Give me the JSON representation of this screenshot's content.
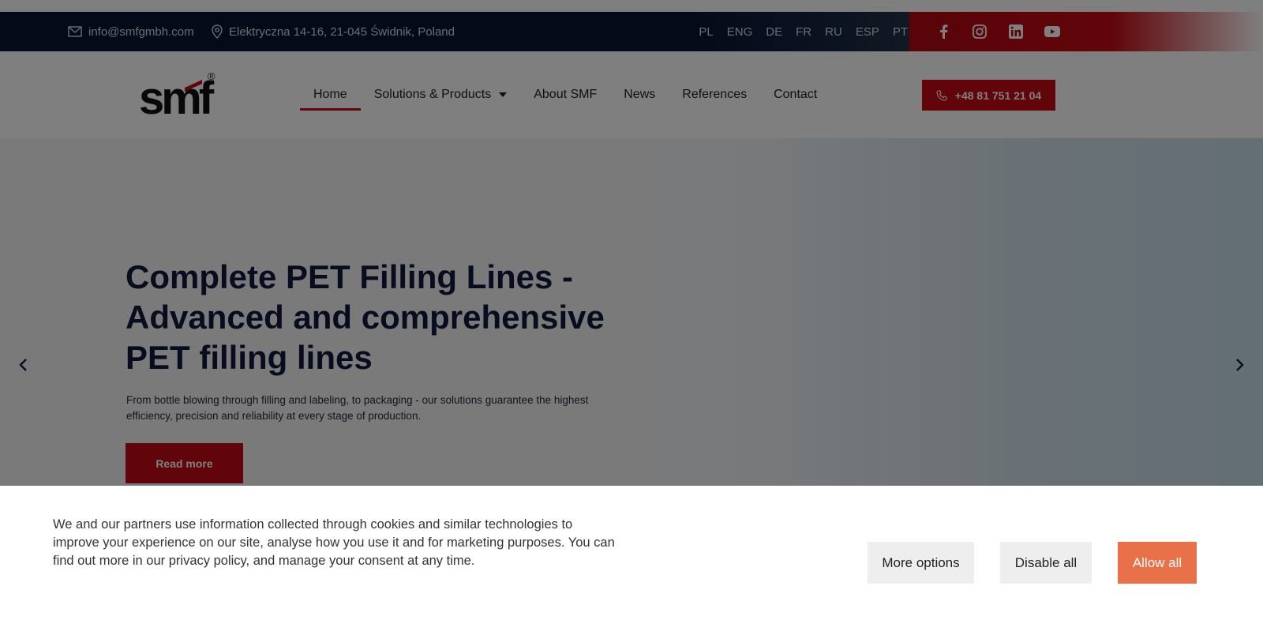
{
  "topbar": {
    "email": "info@smfgmbh.com",
    "address": "Elektryczna 14-16, 21-045 Świdnik, Poland",
    "languages": [
      "PL",
      "ENG",
      "DE",
      "FR",
      "RU",
      "ESP",
      "PT"
    ],
    "social_icons": [
      "facebook-icon",
      "instagram-icon",
      "linkedin-icon",
      "youtube-icon"
    ]
  },
  "header": {
    "logo_text": "smf",
    "logo_mark": "®",
    "nav": [
      {
        "label": "Home",
        "active": true
      },
      {
        "label": "Solutions & Products",
        "has_dropdown": true
      },
      {
        "label": "About SMF"
      },
      {
        "label": "News"
      },
      {
        "label": "References"
      },
      {
        "label": "Contact"
      }
    ],
    "phone": "+48 81 751 21 04"
  },
  "hero": {
    "title": "Complete PET Filling Lines - Advanced and comprehensive PET filling lines",
    "subtitle": "From bottle blowing through filling and labeling, to packaging - our solutions guarantee the highest efficiency, precision and reliability at every stage of production.",
    "button": "Read more"
  },
  "cookie": {
    "text": "We and our partners use information collected through cookies and similar technologies to improve your experience on our site, analyse how you use it and for marketing purposes. You can find out more in our privacy policy, and manage your consent at any time.",
    "more_options": "More options",
    "disable_all": "Disable all",
    "allow_all": "Allow all"
  },
  "colors": {
    "brand_red": "#c40a14",
    "navy": "#0b1533",
    "allow_orange": "#e8714a"
  }
}
